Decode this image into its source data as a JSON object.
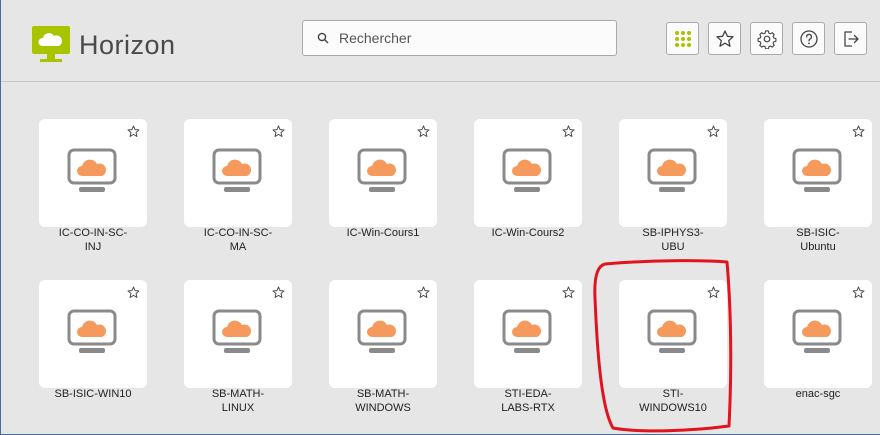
{
  "app": {
    "title": "Horizon"
  },
  "search": {
    "placeholder": "Rechercher"
  },
  "toolbar": [
    "apps-grid-icon",
    "favorites-star-icon",
    "settings-gear-icon",
    "help-icon",
    "logout-icon"
  ],
  "colors": {
    "accent": "#a8c400",
    "cloud": "#f59a5c",
    "monitor": "#8a8a8a",
    "highlight": "#e0141e"
  },
  "desktops": [
    {
      "name": "IC-CO-IN-SC-\nINJ"
    },
    {
      "name": "IC-CO-IN-SC-\nMA"
    },
    {
      "name": "IC-Win-Cours1"
    },
    {
      "name": "IC-Win-Cours2"
    },
    {
      "name": "SB-IPHYS3-\nUBU"
    },
    {
      "name": "SB-ISIC-\nUbuntu"
    },
    {
      "name": "SB-ISIC-WIN10"
    },
    {
      "name": "SB-MATH-\nLINUX"
    },
    {
      "name": "SB-MATH-\nWINDOWS"
    },
    {
      "name": "STI-EDA-\nLABS-RTX"
    },
    {
      "name": "STI-\nWINDOWS10"
    },
    {
      "name": "enac-sgc"
    }
  ]
}
